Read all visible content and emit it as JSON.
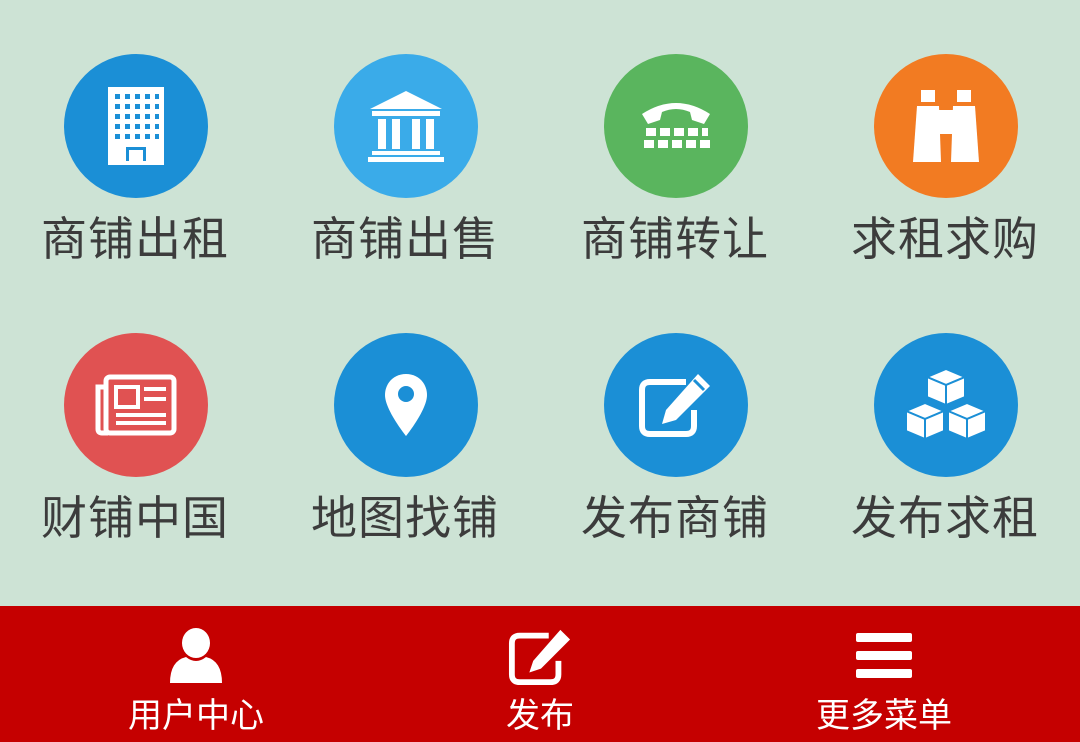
{
  "grid": {
    "items": [
      {
        "label": "商铺出租",
        "icon": "building-icon",
        "color": "#1b8fd6"
      },
      {
        "label": "商铺出售",
        "icon": "bank-icon",
        "color": "#3aabe9"
      },
      {
        "label": "商铺转让",
        "icon": "phone-icon",
        "color": "#5ab55e"
      },
      {
        "label": "求租求购",
        "icon": "binoculars-icon",
        "color": "#f27b22"
      },
      {
        "label": "财铺中国",
        "icon": "newspaper-icon",
        "color": "#e05252"
      },
      {
        "label": "地图找铺",
        "icon": "map-marker-icon",
        "color": "#1b8fd6"
      },
      {
        "label": "发布商铺",
        "icon": "edit-icon",
        "color": "#1b8fd6"
      },
      {
        "label": "发布求租",
        "icon": "cubes-icon",
        "color": "#1b8fd6"
      }
    ]
  },
  "bottom_nav": {
    "items": [
      {
        "label": "用户中心",
        "icon": "user-icon"
      },
      {
        "label": "发布",
        "icon": "edit-icon"
      },
      {
        "label": "更多菜单",
        "icon": "menu-icon"
      }
    ],
    "background": "#c50000"
  },
  "page_background": "#cde3d5"
}
